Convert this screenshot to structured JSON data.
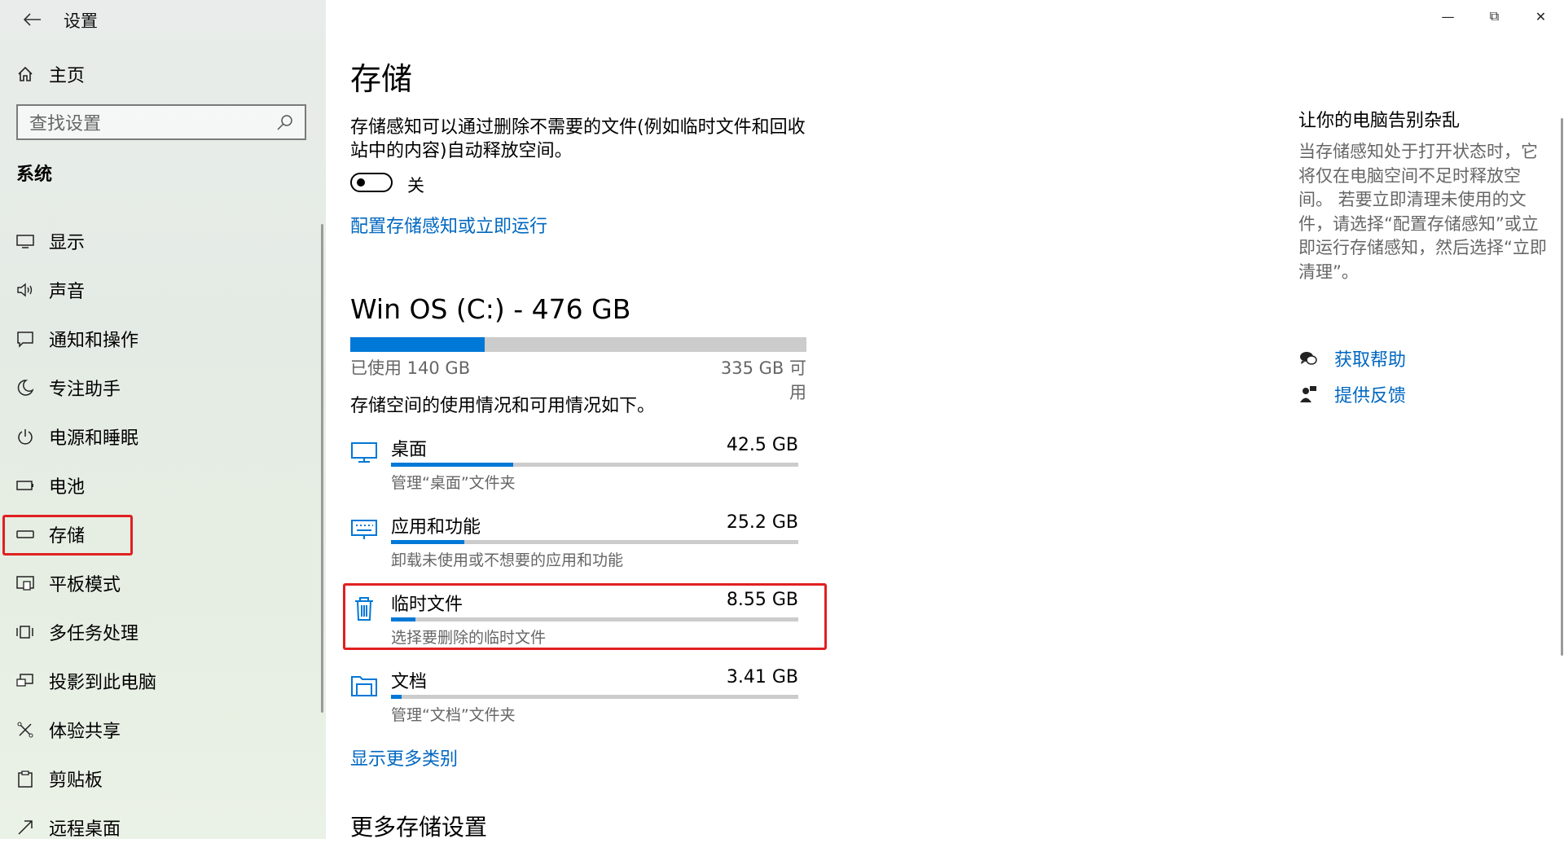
{
  "app": {
    "title": "设置",
    "back_icon": "back-arrow-icon"
  },
  "sidebar": {
    "home_label": "主页",
    "search_placeholder": "查找设置",
    "section_label": "系统",
    "items": [
      {
        "label": "显示",
        "icon": "display-icon"
      },
      {
        "label": "声音",
        "icon": "sound-icon"
      },
      {
        "label": "通知和操作",
        "icon": "notification-icon"
      },
      {
        "label": "专注助手",
        "icon": "focus-moon-icon"
      },
      {
        "label": "电源和睡眠",
        "icon": "power-icon"
      },
      {
        "label": "电池",
        "icon": "battery-icon"
      },
      {
        "label": "存储",
        "icon": "storage-icon",
        "selected": true
      },
      {
        "label": "平板模式",
        "icon": "tablet-icon"
      },
      {
        "label": "多任务处理",
        "icon": "multitask-icon"
      },
      {
        "label": "投影到此电脑",
        "icon": "project-icon"
      },
      {
        "label": "体验共享",
        "icon": "share-icon"
      },
      {
        "label": "剪贴板",
        "icon": "clipboard-icon"
      },
      {
        "label": "远程桌面",
        "icon": "remote-desktop-icon"
      }
    ]
  },
  "main": {
    "title": "存储",
    "description": "存储感知可以通过删除不需要的文件(例如临时文件和回收站中的内容)自动释放空间。",
    "toggle_state": "关",
    "toggle_on": false,
    "config_link": "配置存储感知或立即运行",
    "drive": {
      "title": "Win OS (C:) - 476 GB",
      "used_label": "已使用 140 GB",
      "free_label": "335 GB 可用",
      "used_fraction": 0.294
    },
    "usage_desc": "存储空间的使用情况和可用情况如下。",
    "categories": [
      {
        "name": "桌面",
        "size": "42.5 GB",
        "sub": "管理“桌面”文件夹",
        "icon": "desktop-icon",
        "fraction": 0.3
      },
      {
        "name": "应用和功能",
        "size": "25.2 GB",
        "sub": "卸载未使用或不想要的应用和功能",
        "icon": "apps-keyboard-icon",
        "fraction": 0.18
      },
      {
        "name": "临时文件",
        "size": "8.55 GB",
        "sub": "选择要删除的临时文件",
        "icon": "trash-icon",
        "fraction": 0.06,
        "highlighted": true
      },
      {
        "name": "文档",
        "size": "3.41 GB",
        "sub": "管理“文档”文件夹",
        "icon": "documents-folder-icon",
        "fraction": 0.025
      }
    ],
    "more_link": "显示更多类别",
    "more_settings": "更多存储设置"
  },
  "right": {
    "title": "让你的电脑告别杂乱",
    "text": "当存储感知处于打开状态时，它将仅在电脑空间不足时释放空间。 若要立即清理未使用的文件，请选择“配置存储感知”或立即运行存储感知，然后选择“立即清理”。",
    "help_label": "获取帮助",
    "feedback_label": "提供反馈"
  },
  "colors": {
    "accent": "#0078d7",
    "link": "#0067c0",
    "highlight": "#e02020"
  }
}
